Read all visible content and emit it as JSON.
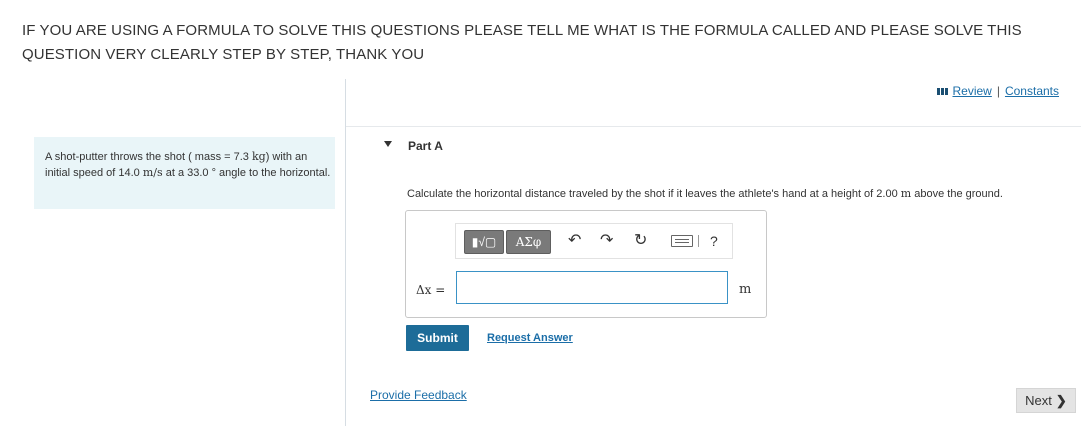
{
  "question": {
    "text": "IF YOU ARE USING A FORMULA TO SOLVE THIS QUESTIONS PLEASE TELL ME WHAT IS THE FORMULA CALLED AND PLEASE SOLVE THIS QUESTION VERY CLEARLY STEP BY STEP, THANK YOU"
  },
  "header_links": {
    "review": "Review",
    "separator": "|",
    "constants": "Constants"
  },
  "problem": {
    "text_1": "A shot-putter throws the shot ( mass = 7.3 ",
    "unit_kg": "kg",
    "text_2": ") with an initial speed of 14.0 ",
    "unit_ms": "m/s",
    "text_3": " at a 33.0 ° angle to the horizontal."
  },
  "part": {
    "title": "Part A",
    "prompt_1": "Calculate the horizontal distance traveled by the shot if it leaves the athlete's hand at a height of 2.00 ",
    "prompt_unit": "m",
    "prompt_2": " above the ground."
  },
  "answer": {
    "label": "Δx =",
    "value": "",
    "unit": "m",
    "toolbar": {
      "templates_label": "▮√▢",
      "greek_label": "ΑΣφ",
      "undo_icon": "↶",
      "redo_icon": "↷",
      "reset_icon": "↻",
      "help_label": "?"
    }
  },
  "actions": {
    "submit": "Submit",
    "request_answer": "Request Answer",
    "provide_feedback": "Provide Feedback",
    "next": "Next",
    "next_icon": "❯"
  },
  "colors": {
    "primary": "#1d6c98",
    "link": "#1b6ea8",
    "problem_bg": "#e9f5f8",
    "input_border": "#3a92c6"
  }
}
